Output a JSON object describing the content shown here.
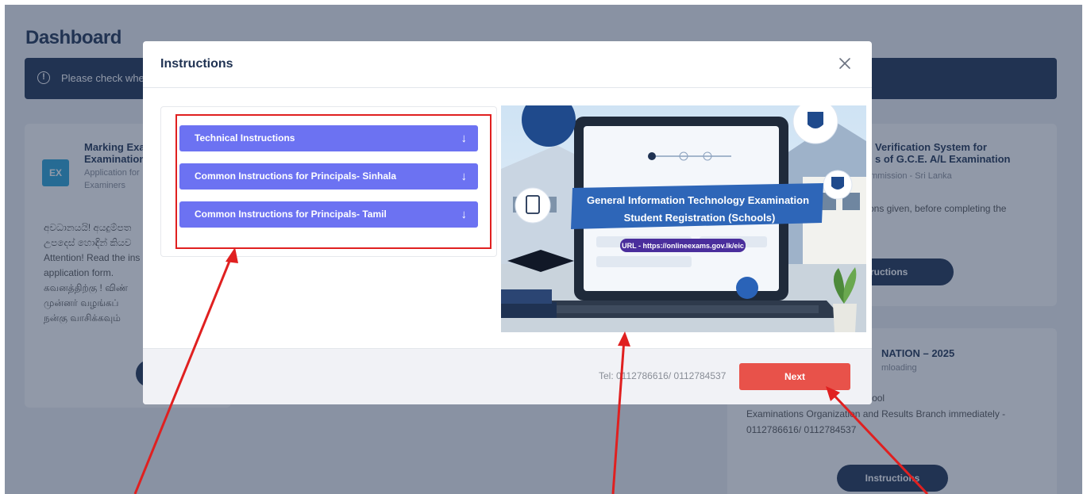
{
  "dashboard": {
    "title": "Dashboard",
    "alert_text": "Please check whe",
    "card_marking": {
      "badge": "EX",
      "title": "Marking Exa\nExamination",
      "subtitle": "Application for\nExaminers",
      "body": "අවධානයයි! අයදුම්පත\nඋපදෙස් හොඳින් කියව\nAttention! Read the ins\napplication form.\nகவனத்திற்கு ! விண்\nமுன்னர் வழங்கப்\nநன்கு வாசிக்கவும்"
    },
    "card_verification": {
      "title": "Verification System for\ns of G.C.E. A/L Examination",
      "subtitle": "mmission - Sri Lanka",
      "body": "ons given, before completing the",
      "button": "tructions"
    },
    "card_exam": {
      "title": "NATION – 2025",
      "subtitle": "mloading",
      "body": "our school, please inform School\nExaminations Organization and Results Branch immediately -\n0112786616/ 0112784537",
      "button": "Instructions"
    }
  },
  "modal": {
    "title": "Instructions",
    "accordion": [
      {
        "label": "Technical Instructions"
      },
      {
        "label": "Common Instructions for Principals- Sinhala"
      },
      {
        "label": "Common Instructions for Principals- Tamil"
      }
    ],
    "banner": {
      "line1": "General Information Technology Examination",
      "line2": "Student Registration (Schools)",
      "url": "URL - https://onlineexams.gov.lk/eic"
    },
    "footer": {
      "tel": "Tel: 0112786616/ 0112784537",
      "next": "Next"
    }
  },
  "colors": {
    "navy": "#1f3252",
    "accordion": "#6c72f2",
    "next": "#e8524a",
    "annotation": "#e02020"
  }
}
